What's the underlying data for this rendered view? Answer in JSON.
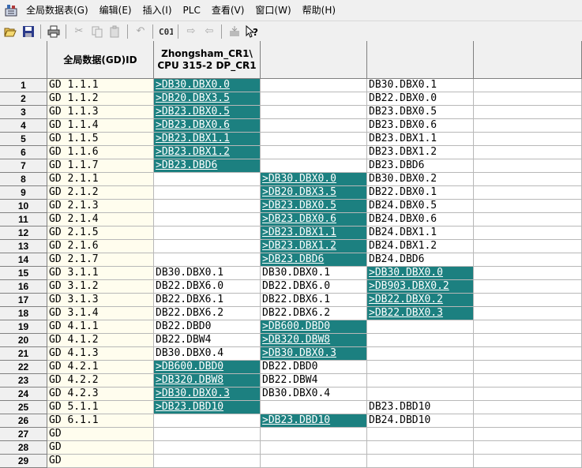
{
  "menu": [
    "全局数据表(G)",
    "编辑(E)",
    "插入(I)",
    "PLC",
    "查看(V)",
    "窗口(W)",
    "帮助(H)"
  ],
  "toolbar": [
    "open-icon",
    "save-icon",
    "print-icon",
    "cut-icon",
    "copy-icon",
    "paste-icon",
    "undo-icon",
    "compile-icon",
    "download-icon",
    "upload-icon",
    "monitor-icon",
    "help-icon"
  ],
  "headers": {
    "id": "全局数据(GD)ID",
    "cpu1": "Zhongsham_CR1\\ CPU 315-2 DP_CR1",
    "cpu2": "",
    "cpu3": "",
    "cpu4": ""
  },
  "highlight_color": "#1c8080",
  "rows": [
    {
      "n": "1",
      "id": "GD 1.1.1",
      "c": [
        ">DB30.DBX0.0",
        "",
        "DB30.DBX0.1",
        ""
      ],
      "h": [
        1,
        0,
        0,
        0
      ]
    },
    {
      "n": "2",
      "id": "GD 1.1.2",
      "c": [
        ">DB20.DBX3.5",
        "",
        "DB22.DBX0.0",
        ""
      ],
      "h": [
        1,
        0,
        0,
        0
      ]
    },
    {
      "n": "3",
      "id": "GD 1.1.3",
      "c": [
        ">DB23.DBX0.5",
        "",
        "DB23.DBX0.5",
        ""
      ],
      "h": [
        1,
        0,
        0,
        0
      ]
    },
    {
      "n": "4",
      "id": "GD 1.1.4",
      "c": [
        ">DB23.DBX0.6",
        "",
        "DB23.DBX0.6",
        ""
      ],
      "h": [
        1,
        0,
        0,
        0
      ]
    },
    {
      "n": "5",
      "id": "GD 1.1.5",
      "c": [
        ">DB23.DBX1.1",
        "",
        "DB23.DBX1.1",
        ""
      ],
      "h": [
        1,
        0,
        0,
        0
      ]
    },
    {
      "n": "6",
      "id": "GD 1.1.6",
      "c": [
        ">DB23.DBX1.2",
        "",
        "DB23.DBX1.2",
        ""
      ],
      "h": [
        1,
        0,
        0,
        0
      ]
    },
    {
      "n": "7",
      "id": "GD 1.1.7",
      "c": [
        ">DB23.DBD6",
        "",
        "DB23.DBD6",
        ""
      ],
      "h": [
        1,
        0,
        0,
        0
      ]
    },
    {
      "n": "8",
      "id": "GD 2.1.1",
      "c": [
        "",
        ">DB30.DBX0.0",
        "DB30.DBX0.2",
        ""
      ],
      "h": [
        0,
        1,
        0,
        0
      ]
    },
    {
      "n": "9",
      "id": "GD 2.1.2",
      "c": [
        "",
        ">DB20.DBX3.5",
        "DB22.DBX0.1",
        ""
      ],
      "h": [
        0,
        1,
        0,
        0
      ]
    },
    {
      "n": "10",
      "id": "GD 2.1.3",
      "c": [
        "",
        ">DB23.DBX0.5",
        "DB24.DBX0.5",
        ""
      ],
      "h": [
        0,
        1,
        0,
        0
      ]
    },
    {
      "n": "11",
      "id": "GD 2.1.4",
      "c": [
        "",
        ">DB23.DBX0.6",
        "DB24.DBX0.6",
        ""
      ],
      "h": [
        0,
        1,
        0,
        0
      ]
    },
    {
      "n": "12",
      "id": "GD 2.1.5",
      "c": [
        "",
        ">DB23.DBX1.1",
        "DB24.DBX1.1",
        ""
      ],
      "h": [
        0,
        1,
        0,
        0
      ]
    },
    {
      "n": "13",
      "id": "GD 2.1.6",
      "c": [
        "",
        ">DB23.DBX1.2",
        "DB24.DBX1.2",
        ""
      ],
      "h": [
        0,
        1,
        0,
        0
      ]
    },
    {
      "n": "14",
      "id": "GD 2.1.7",
      "c": [
        "",
        ">DB23.DBD6",
        "DB24.DBD6",
        ""
      ],
      "h": [
        0,
        1,
        0,
        0
      ]
    },
    {
      "n": "15",
      "id": "GD 3.1.1",
      "c": [
        "DB30.DBX0.1",
        "DB30.DBX0.1",
        ">DB30.DBX0.0",
        ""
      ],
      "h": [
        0,
        0,
        1,
        0
      ]
    },
    {
      "n": "16",
      "id": "GD 3.1.2",
      "c": [
        "DB22.DBX6.0",
        "DB22.DBX6.0",
        ">DB903.DBX0.2",
        ""
      ],
      "h": [
        0,
        0,
        1,
        0
      ]
    },
    {
      "n": "17",
      "id": "GD 3.1.3",
      "c": [
        "DB22.DBX6.1",
        "DB22.DBX6.1",
        ">DB22.DBX0.2",
        ""
      ],
      "h": [
        0,
        0,
        1,
        0
      ]
    },
    {
      "n": "18",
      "id": "GD 3.1.4",
      "c": [
        "DB22.DBX6.2",
        "DB22.DBX6.2",
        ">DB22.DBX0.3",
        ""
      ],
      "h": [
        0,
        0,
        1,
        0
      ]
    },
    {
      "n": "19",
      "id": "GD 4.1.1",
      "c": [
        "DB22.DBD0",
        ">DB600.DBD0",
        "",
        ""
      ],
      "h": [
        0,
        1,
        0,
        0
      ]
    },
    {
      "n": "20",
      "id": "GD 4.1.2",
      "c": [
        "DB22.DBW4",
        ">DB320.DBW8",
        "",
        ""
      ],
      "h": [
        0,
        1,
        0,
        0
      ]
    },
    {
      "n": "21",
      "id": "GD 4.1.3",
      "c": [
        "DB30.DBX0.4",
        ">DB30.DBX0.3",
        "",
        ""
      ],
      "h": [
        0,
        1,
        0,
        0
      ]
    },
    {
      "n": "22",
      "id": "GD 4.2.1",
      "c": [
        ">DB600.DBD0",
        "DB22.DBD0",
        "",
        ""
      ],
      "h": [
        1,
        0,
        0,
        0
      ]
    },
    {
      "n": "23",
      "id": "GD 4.2.2",
      "c": [
        ">DB320.DBW8",
        "DB22.DBW4",
        "",
        ""
      ],
      "h": [
        1,
        0,
        0,
        0
      ]
    },
    {
      "n": "24",
      "id": "GD 4.2.3",
      "c": [
        ">DB30.DBX0.3",
        "DB30.DBX0.4",
        "",
        ""
      ],
      "h": [
        1,
        0,
        0,
        0
      ]
    },
    {
      "n": "25",
      "id": "GD 5.1.1",
      "c": [
        ">DB23.DBD10",
        "",
        "DB23.DBD10",
        ""
      ],
      "h": [
        1,
        0,
        0,
        0
      ]
    },
    {
      "n": "26",
      "id": "GD 6.1.1",
      "c": [
        "",
        ">DB23.DBD10",
        "DB24.DBD10",
        ""
      ],
      "h": [
        0,
        1,
        0,
        0
      ]
    },
    {
      "n": "27",
      "id": "GD",
      "c": [
        "",
        "",
        "",
        ""
      ],
      "h": [
        0,
        0,
        0,
        0
      ]
    },
    {
      "n": "28",
      "id": "GD",
      "c": [
        "",
        "",
        "",
        ""
      ],
      "h": [
        0,
        0,
        0,
        0
      ]
    },
    {
      "n": "29",
      "id": "GD",
      "c": [
        "",
        "",
        "",
        ""
      ],
      "h": [
        0,
        0,
        0,
        0
      ]
    }
  ]
}
